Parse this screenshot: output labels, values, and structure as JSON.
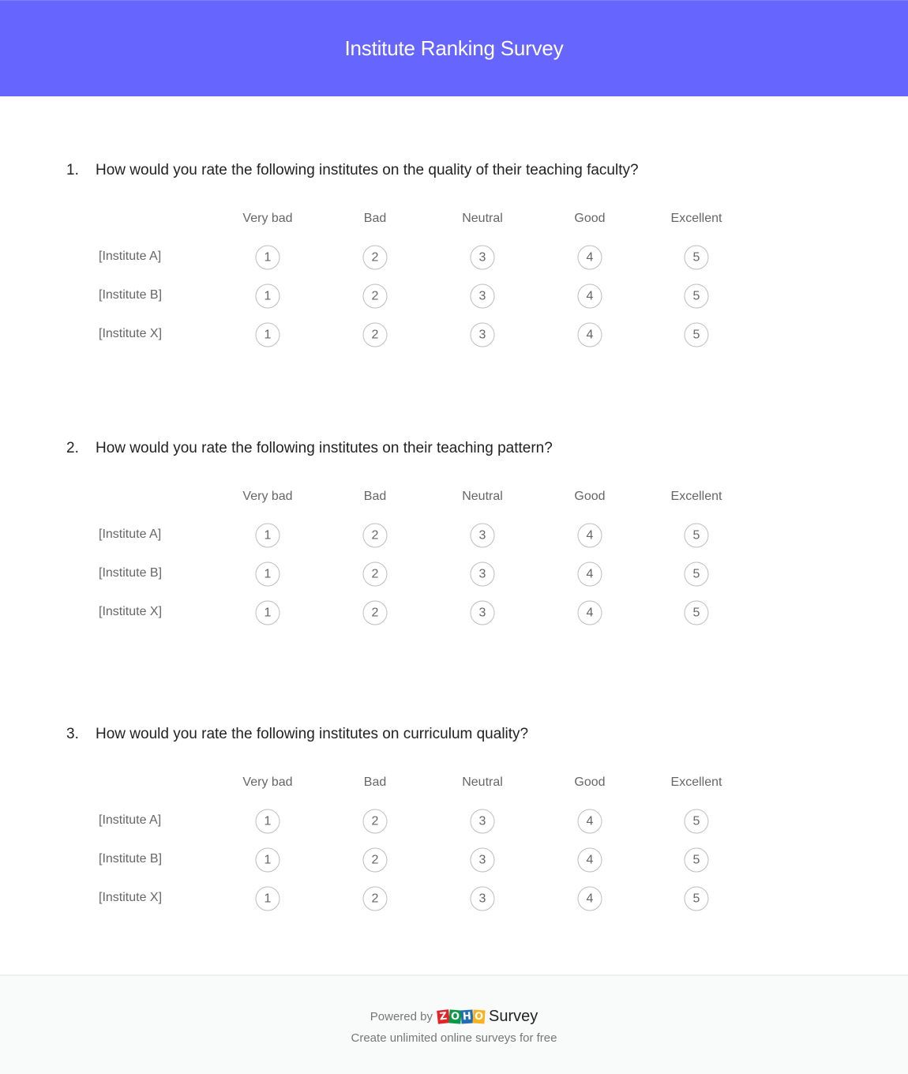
{
  "header": {
    "title": "Institute Ranking Survey",
    "background": "#6666ff"
  },
  "columns": [
    "Very bad",
    "Bad",
    "Neutral",
    "Good",
    "Excellent"
  ],
  "questions": [
    {
      "number": "1.",
      "text": "How would you rate the following institutes on the quality of their teaching faculty?",
      "rows": [
        "[Institute A]",
        "[Institute B]",
        "[Institute X]"
      ],
      "options": [
        "1",
        "2",
        "3",
        "4",
        "5"
      ]
    },
    {
      "number": "2.",
      "text": "How would you rate the following institutes on their teaching pattern?",
      "rows": [
        "[Institute A]",
        "[Institute B]",
        "[Institute X]"
      ],
      "options": [
        "1",
        "2",
        "3",
        "4",
        "5"
      ]
    },
    {
      "number": "3.",
      "text": "How would you rate the following institutes on curriculum quality?",
      "rows": [
        "[Institute A]",
        "[Institute B]",
        "[Institute X]"
      ],
      "options": [
        "1",
        "2",
        "3",
        "4",
        "5"
      ]
    }
  ],
  "footer": {
    "powered_by": "Powered by",
    "brand_letters": [
      "Z",
      "O",
      "H",
      "O"
    ],
    "brand_colors": [
      "#e42527",
      "#089949",
      "#226db4",
      "#f9b21d"
    ],
    "product": "Survey",
    "tagline": "Create unlimited online surveys for free"
  }
}
